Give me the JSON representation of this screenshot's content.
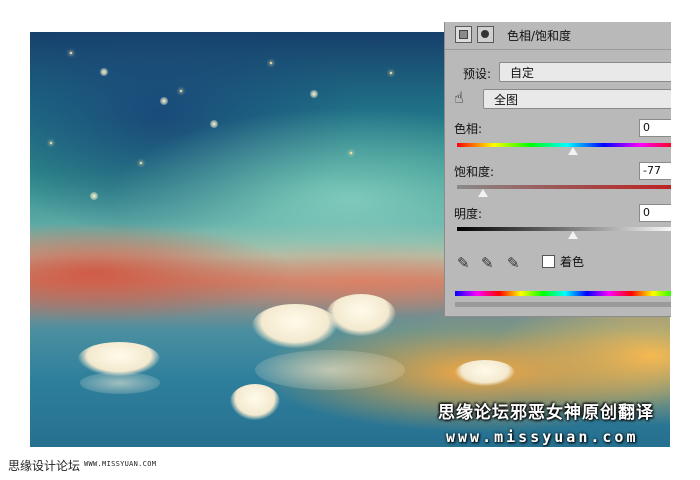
{
  "panel": {
    "title": "色相/饱和度",
    "preset_label": "预设:",
    "preset_value": "自定",
    "channel_value": "全图",
    "hue_label": "色相:",
    "hue_value": "0",
    "saturation_label": "饱和度:",
    "saturation_value": "-77",
    "lightness_label": "明度:",
    "lightness_value": "0",
    "colorize_label": "着色",
    "colorize_checked": false,
    "icons": [
      "adjustment-layer-icon",
      "mask-icon",
      "hand-target-icon",
      "eyedropper-icon",
      "eyedropper-plus-icon",
      "eyedropper-minus-icon"
    ]
  },
  "watermark": {
    "line1": "思缘论坛邪恶女神原创翻译",
    "line2": "www.missyuan.com"
  },
  "caption": {
    "site_name": "思缘设计论坛",
    "site_url": "WWW.MISSYUAN.COM"
  }
}
